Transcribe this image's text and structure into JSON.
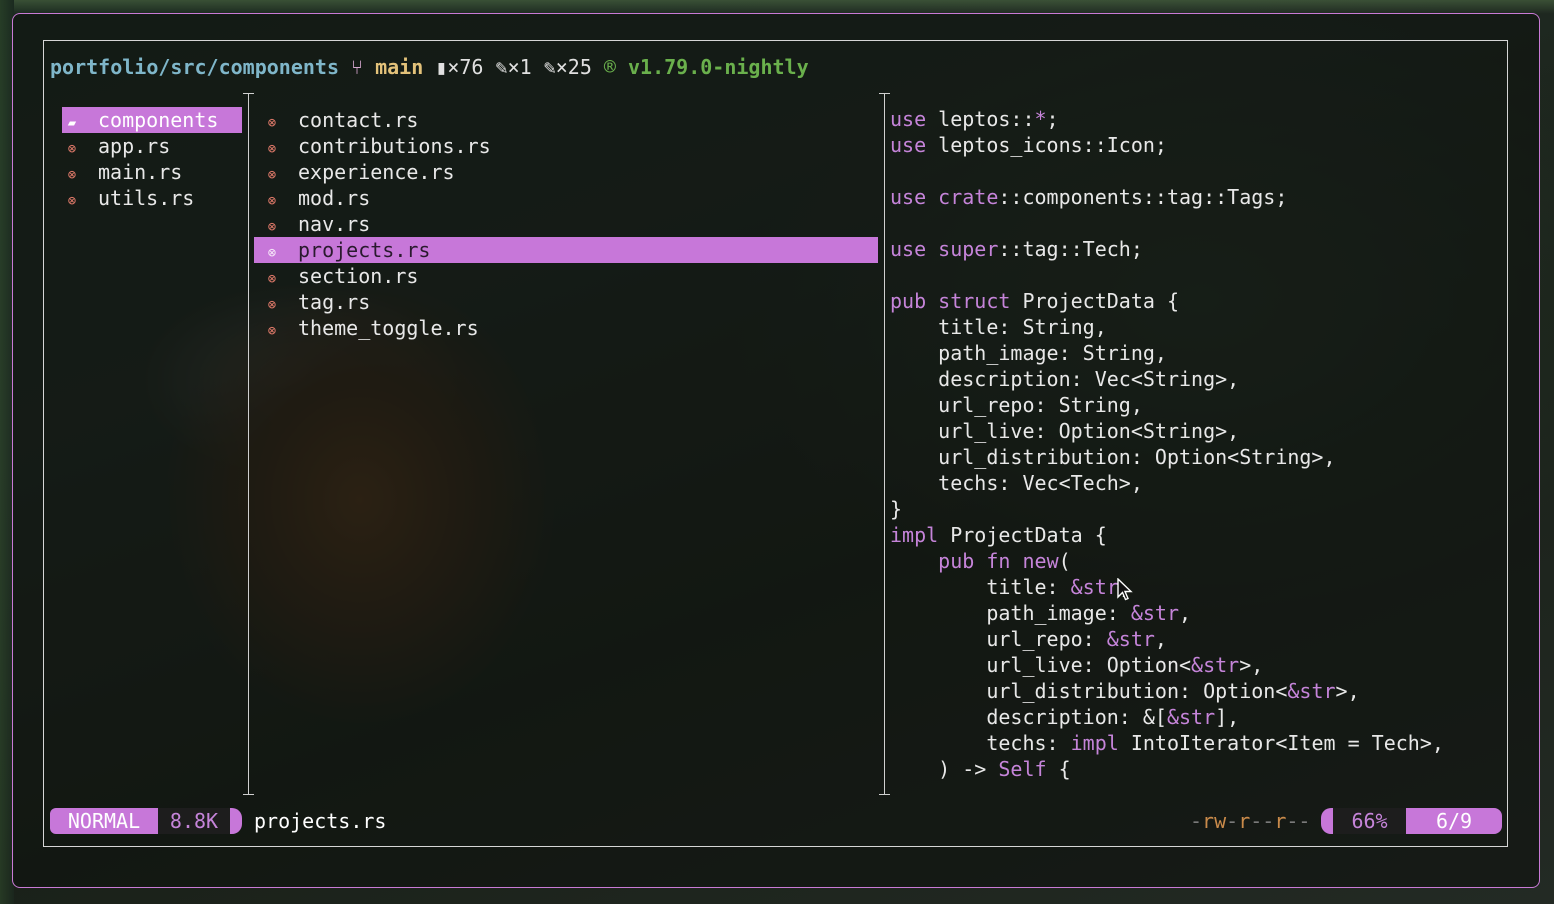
{
  "header": {
    "path": "portfolio/src/components",
    "branch_icon": "git-branch-icon",
    "branch": "main",
    "stat_files_icon": "file-icon",
    "stat_files": "×76",
    "stat_modified_icon": "edit-icon",
    "stat_modified": "×1",
    "stat_added_icon": "file-plus-icon",
    "stat_added": "×25",
    "rust_icon": "rust-icon",
    "version": "v1.79.0-nightly"
  },
  "parent_pane": {
    "items": [
      {
        "name": "components",
        "icon": "folder-icon",
        "selected": true
      },
      {
        "name": "app.rs",
        "icon": "rust-file-icon"
      },
      {
        "name": "main.rs",
        "icon": "rust-file-icon"
      },
      {
        "name": "utils.rs",
        "icon": "rust-file-icon"
      }
    ]
  },
  "current_pane": {
    "items": [
      {
        "name": "contact.rs"
      },
      {
        "name": "contributions.rs"
      },
      {
        "name": "experience.rs"
      },
      {
        "name": "mod.rs"
      },
      {
        "name": "nav.rs"
      },
      {
        "name": "projects.rs",
        "selected": true
      },
      {
        "name": "section.rs"
      },
      {
        "name": "tag.rs"
      },
      {
        "name": "theme_toggle.rs"
      }
    ]
  },
  "preview": {
    "lines": [
      "use leptos::*;",
      "use leptos_icons::Icon;",
      "",
      "use crate::components::tag::Tags;",
      "",
      "use super::tag::Tech;",
      "",
      "pub struct ProjectData {",
      "    title: String,",
      "    path_image: String,",
      "    description: Vec<String>,",
      "    url_repo: String,",
      "    url_live: Option<String>,",
      "    url_distribution: Option<String>,",
      "    techs: Vec<Tech>,",
      "}",
      "impl ProjectData {",
      "    pub fn new(",
      "        title: &str,",
      "        path_image: &str,",
      "        url_repo: &str,",
      "        url_live: Option<&str>,",
      "        url_distribution: Option<&str>,",
      "        description: &[&str],",
      "        techs: impl IntoIterator<Item = Tech>,",
      "    ) -> Self {"
    ]
  },
  "statusbar": {
    "mode": "NORMAL",
    "size": "8.8K",
    "filename": "projects.rs",
    "permissions": "-rw-r--r--",
    "percent": "66%",
    "position": "6/9"
  },
  "colors": {
    "accent": "#c777d9",
    "keyword": "#c584d9",
    "path": "#7fb6c9",
    "branch": "#e3c27a",
    "version": "#6ab04c"
  }
}
